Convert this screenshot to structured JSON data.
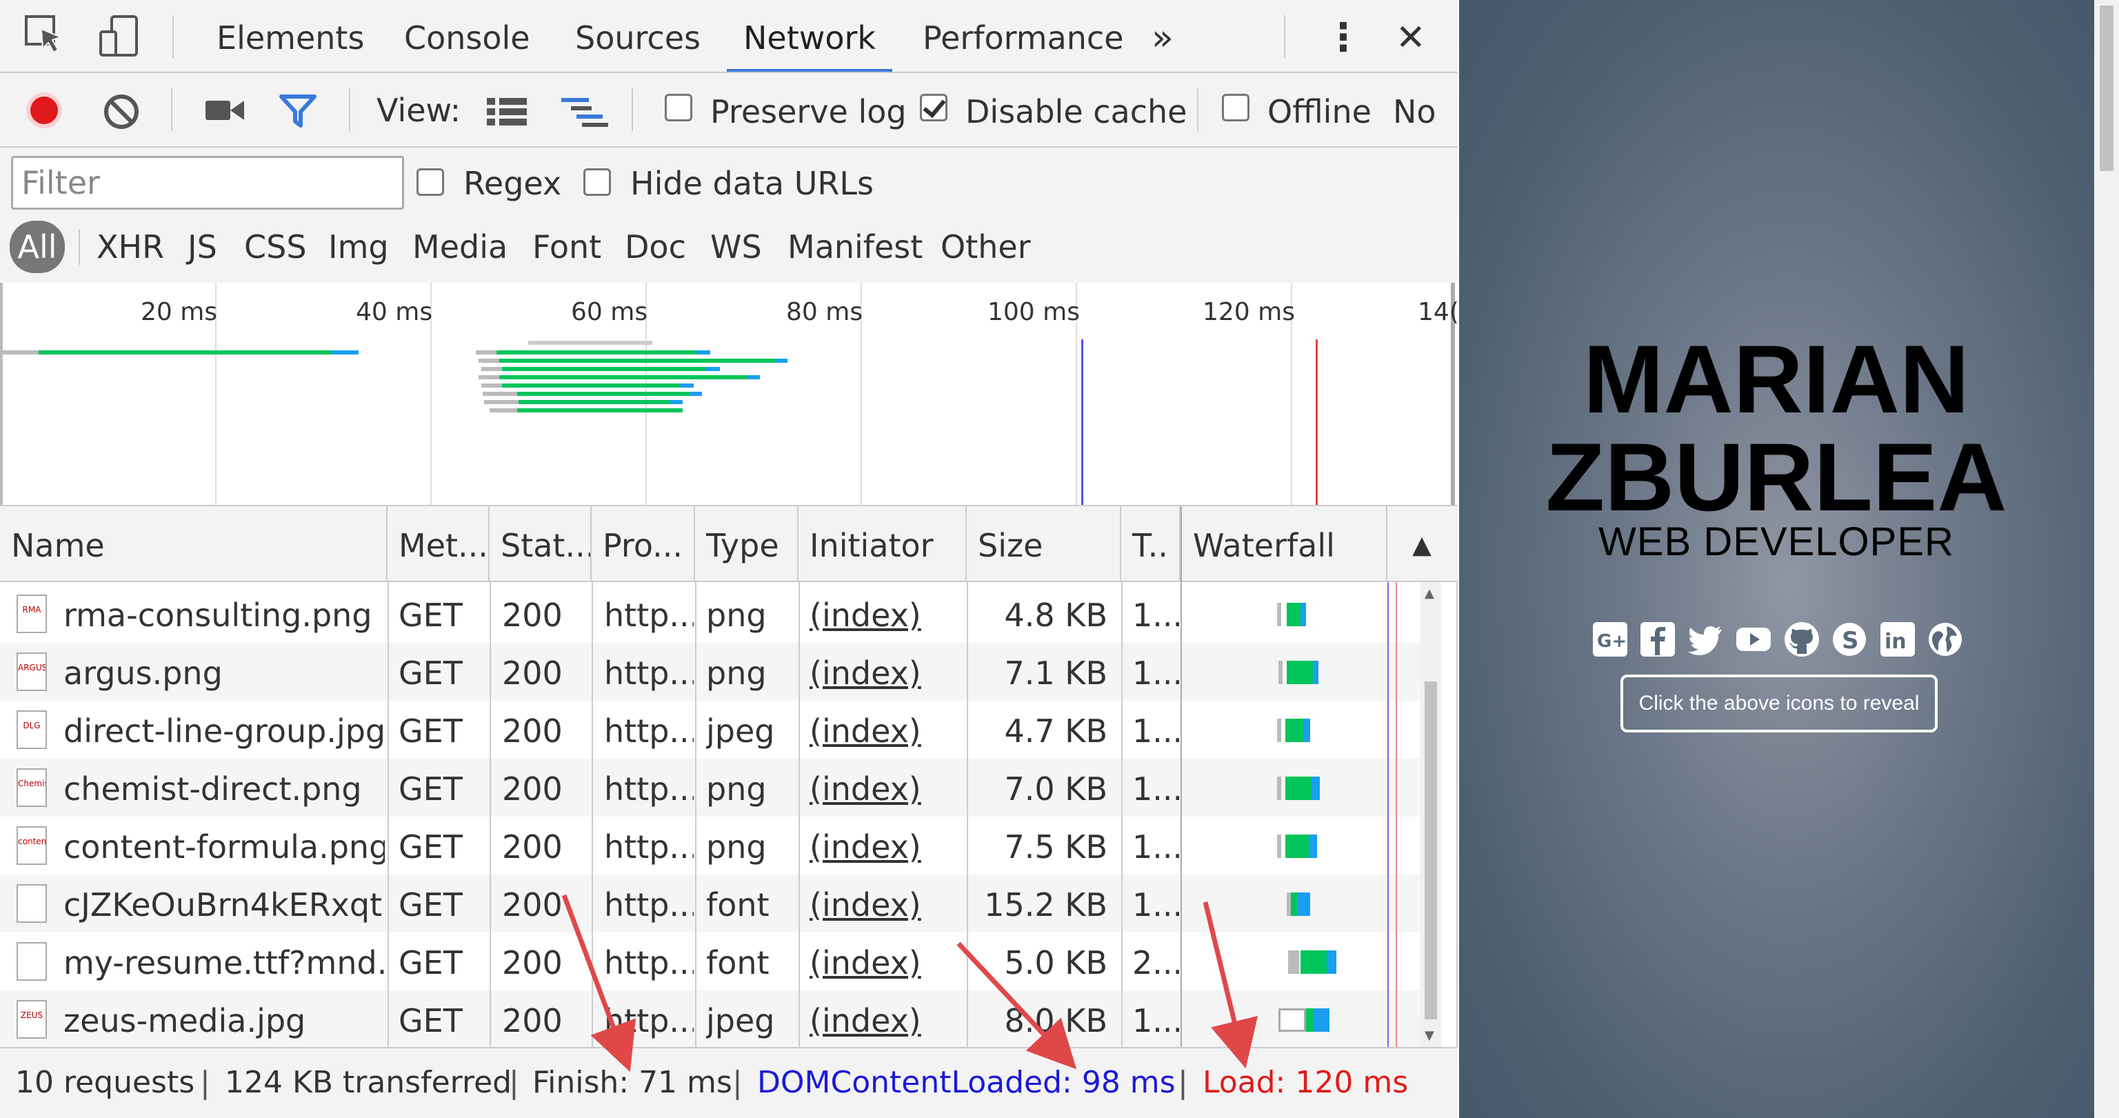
{
  "tabs": {
    "items": [
      "Elements",
      "Console",
      "Sources",
      "Network",
      "Performance"
    ],
    "active": "Network",
    "more": "»",
    "kebab": "⋮",
    "close": "✕"
  },
  "toolbar": {
    "view_label": "View:",
    "preserve_log": "Preserve log",
    "preserve_log_checked": false,
    "disable_cache": "Disable cache",
    "disable_cache_checked": true,
    "offline": "Offline",
    "throttle": "No",
    "record_color": "#e0191c",
    "filter_icon_color": "#3879d9"
  },
  "filter": {
    "placeholder": "Filter",
    "regex": "Regex",
    "hide_data_urls": "Hide data URLs",
    "types": [
      "All",
      "XHR",
      "JS",
      "CSS",
      "Img",
      "Media",
      "Font",
      "Doc",
      "WS",
      "Manifest",
      "Other"
    ],
    "active_type": "All"
  },
  "overview": {
    "ticks": [
      "20 ms",
      "40 ms",
      "60 ms",
      "80 ms",
      "100 ms",
      "120 ms",
      "14("
    ],
    "domcontentloaded_color": "#5050f0",
    "load_color": "#e04040"
  },
  "table": {
    "headers": [
      "Name",
      "Met...",
      "Stat...",
      "Pro...",
      "Type",
      "Initiator",
      "Size",
      "T..",
      "Waterfall"
    ],
    "sort_indicator": "▲",
    "rows": [
      {
        "icon": "rma-logo-icon",
        "icon_text": "RMA",
        "name": "rma-consulting.png",
        "method": "GET",
        "status": "200",
        "protocol": "http...",
        "type": "png",
        "initiator": "(index)",
        "size": "4.8 KB",
        "time": "1..."
      },
      {
        "icon": "argus-logo-icon",
        "icon_text": "ARGUS",
        "name": "argus.png",
        "method": "GET",
        "status": "200",
        "protocol": "http...",
        "type": "png",
        "initiator": "(index)",
        "size": "7.1 KB",
        "time": "1..."
      },
      {
        "icon": "dlg-logo-icon",
        "icon_text": "DLG",
        "name": "direct-line-group.jpg",
        "method": "GET",
        "status": "200",
        "protocol": "http...",
        "type": "jpeg",
        "initiator": "(index)",
        "size": "4.7 KB",
        "time": "1..."
      },
      {
        "icon": "chemist-direct-logo-icon",
        "icon_text": "Chemist Direct",
        "name": "chemist-direct.png",
        "method": "GET",
        "status": "200",
        "protocol": "http...",
        "type": "png",
        "initiator": "(index)",
        "size": "7.0 KB",
        "time": "1..."
      },
      {
        "icon": "content-formula-logo-icon",
        "icon_text": "content formula",
        "name": "content-formula.png",
        "method": "GET",
        "status": "200",
        "protocol": "http...",
        "type": "png",
        "initiator": "(index)",
        "size": "7.5 KB",
        "time": "1..."
      },
      {
        "icon": "blank-file-icon",
        "icon_text": "",
        "name": "cJZKeOuBrn4kERxqt...",
        "method": "GET",
        "status": "200",
        "protocol": "http...",
        "type": "font",
        "initiator": "(index)",
        "size": "15.2 KB",
        "time": "1..."
      },
      {
        "icon": "blank-file-icon",
        "icon_text": "",
        "name": "my-resume.ttf?mnd...",
        "method": "GET",
        "status": "200",
        "protocol": "http...",
        "type": "font",
        "initiator": "(index)",
        "size": "5.0 KB",
        "time": "2..."
      },
      {
        "icon": "zeus-logo-icon",
        "icon_text": "ZEUS",
        "name": "zeus-media.jpg",
        "method": "GET",
        "status": "200",
        "protocol": "http...",
        "type": "jpeg",
        "initiator": "(index)",
        "size": "8.0 KB",
        "time": "1..."
      }
    ]
  },
  "status": {
    "requests": "10 requests",
    "transferred": "124 KB transferred",
    "finish": "Finish: 71 ms",
    "dcl": "DOMContentLoaded: 98 ms",
    "load": "Load: 120 ms",
    "dcl_color": "#1a1ad8",
    "load_color": "#e01b1b",
    "separator": "|"
  },
  "site": {
    "name_line1": "MARIAN",
    "name_line2": "ZBURLEA",
    "role": "WEB DEVELOPER",
    "social_icons": [
      "google-plus-icon",
      "facebook-icon",
      "twitter-icon",
      "youtube-icon",
      "github-icon",
      "skype-icon",
      "linkedin-icon",
      "globe-icon"
    ],
    "reveal_button": "Click the above icons to reveal",
    "menu_icon": "hamburger-menu-icon"
  },
  "annotation_arrow_color": "#e04848"
}
